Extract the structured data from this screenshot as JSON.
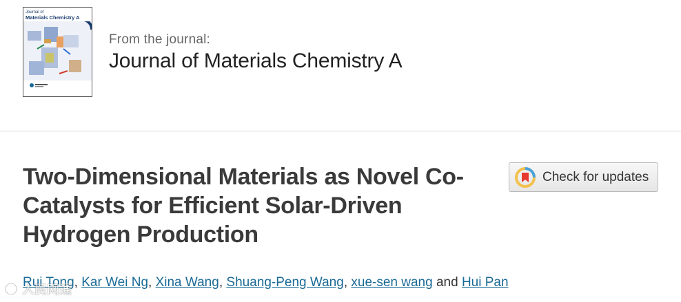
{
  "journal": {
    "cover_title_line1": "Journal of",
    "cover_title_line2": "Materials Chemistry A",
    "from_label": "From the journal:",
    "name": "Journal of Materials Chemistry A"
  },
  "article": {
    "title": "Two-Dimensional Materials as Novel Co-Catalysts for Efficient Solar-Driven Hydrogen Production"
  },
  "check_updates": {
    "label": "Check for updates",
    "icon": "crossmark-icon"
  },
  "authors": {
    "names": [
      "Rui Tong",
      "Kar Wei Ng",
      "Xina Wang",
      "Shuang-Peng Wang",
      "xue-sen wang",
      "Hui Pan"
    ],
    "separator": ",",
    "conjunction": "and"
  },
  "watermark": {
    "text": "人民网通",
    "icon": "watermark-logo-icon"
  },
  "colors": {
    "link": "#1a6a96",
    "title": "#3a3a3a",
    "divider": "#dcdcdc"
  }
}
